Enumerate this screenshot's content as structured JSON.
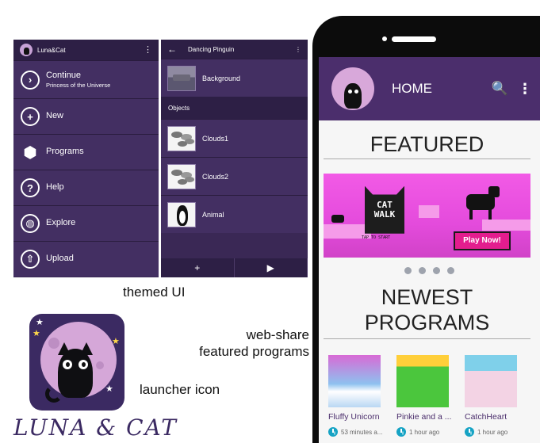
{
  "menu_screen": {
    "title": "Luna&Cat",
    "more_icon": "⋮",
    "items": [
      {
        "icon": "chevron-right-circle-icon",
        "glyph": "›",
        "label": "Continue",
        "sublabel": "Princess of the Universe"
      },
      {
        "icon": "plus-circle-icon",
        "glyph": "+",
        "label": "New"
      },
      {
        "icon": "cube-icon",
        "glyph": "⬢",
        "label": "Programs"
      },
      {
        "icon": "help-circle-icon",
        "glyph": "?",
        "label": "Help"
      },
      {
        "icon": "globe-icon",
        "glyph": "◍",
        "label": "Explore"
      },
      {
        "icon": "upload-circle-icon",
        "glyph": "⇧",
        "label": "Upload"
      }
    ]
  },
  "objects_screen": {
    "back_icon": "←",
    "title": "Dancing Pinguin",
    "more_icon": "⋮",
    "background_label": "Background",
    "objects_header": "Objects",
    "objects": [
      {
        "label": "Clouds1"
      },
      {
        "label": "Clouds2"
      },
      {
        "label": "Animal"
      }
    ],
    "add_icon": "+",
    "play_icon": "▶"
  },
  "captions": {
    "themed_ui": "themed UI",
    "web_share_line1": "web-share",
    "web_share_line2": "featured programs",
    "launcher_icon": "launcher icon"
  },
  "brand": "LUNA & CAT",
  "phone": {
    "app_bar": {
      "title": "HOME",
      "search_icon": "🔍",
      "more_icon": "⋮"
    },
    "featured": {
      "title": "FEATURED",
      "banner": {
        "logo_line1": "CAT",
        "logo_line2": "WALK",
        "tap_text": "TAP TO START",
        "play_button": "Play Now!"
      },
      "carousel_dots": 4
    },
    "newest": {
      "title_line1": "NEWEST",
      "title_line2": "PROGRAMS",
      "programs": [
        {
          "name": "Fluffy Unicorn",
          "time": "53 minutes a..."
        },
        {
          "name": "Pinkie and a ...",
          "time": "1 hour ago"
        },
        {
          "name": "CatchHeart",
          "time": "1 hour ago"
        }
      ]
    }
  },
  "colors": {
    "menu_bg": "#432f62",
    "menu_bar": "#2d1f45",
    "app_bar": "#4b2e6c",
    "banner": "#e44bdc",
    "play_button": "#e31d8e",
    "clock": "#16a3c4"
  }
}
